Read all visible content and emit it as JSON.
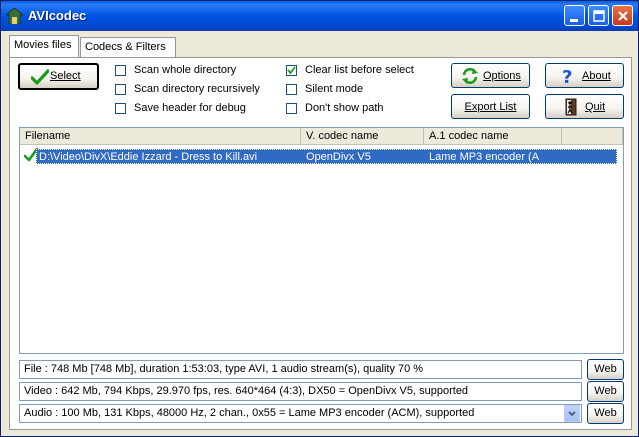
{
  "window": {
    "title": "AVIcodec"
  },
  "tabs": [
    {
      "label": "Movies files"
    },
    {
      "label": "Codecs & Filters"
    }
  ],
  "buttons": {
    "select": "Select",
    "options": "Options",
    "about": "About",
    "export_list": "Export List",
    "quit": "Quit",
    "web": "Web"
  },
  "checkboxes": [
    {
      "label": "Scan whole directory",
      "checked": false
    },
    {
      "label": "Scan directory recursively",
      "checked": false
    },
    {
      "label": "Save header for debug",
      "checked": false
    },
    {
      "label": "Clear list before select",
      "checked": true
    },
    {
      "label": "Silent mode",
      "checked": false
    },
    {
      "label": "Don't show path",
      "checked": false
    }
  ],
  "list": {
    "columns": [
      "Filename",
      "V. codec name",
      "A.1 codec name",
      ""
    ],
    "rows": [
      {
        "filename": "D:\\Video\\DivX\\Eddie Izzard - Dress to Kill.avi",
        "vcodec": "OpenDivx V5",
        "acodec": "Lame MP3 encoder (A",
        "status": "ok"
      }
    ]
  },
  "info": {
    "file": "File : 748 Mb [748 Mb], duration 1:53:03, type AVI, 1 audio stream(s), quality 70 %",
    "video": "Video : 642 Mb, 794 Kbps, 29.970 fps, res. 640*464 (4:3),  DX50 = OpenDivx V5, supported",
    "audio": "Audio : 100 Mb, 131 Kbps, 48000 Hz, 2 chan., 0x55 = Lame MP3 encoder (ACM), supported"
  },
  "icons": {
    "app": "avicodec-app-icon",
    "select": "checkmark-icon",
    "options": "refresh-icon",
    "about": "question-mark-icon",
    "quit": "exit-door-icon"
  },
  "colors": {
    "titlebar": "#0054e3",
    "selection": "#316ac5",
    "check_green": "#1a9a1a"
  }
}
